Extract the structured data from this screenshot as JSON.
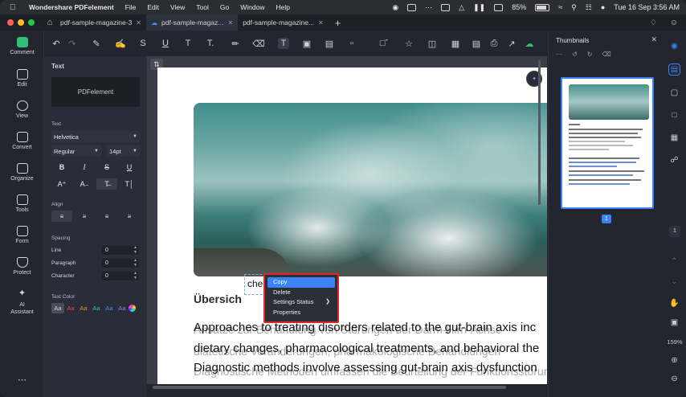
{
  "menubar": {
    "app_name": "Wondershare PDFelement",
    "items": [
      "File",
      "Edit",
      "View",
      "Tool",
      "Go",
      "Window",
      "Help"
    ],
    "battery": "85%",
    "datetime": "Tue 16 Sep  3:56 AM"
  },
  "tabs": [
    {
      "label": "pdf-sample-magazine-3",
      "active": false
    },
    {
      "label": "pdf-sample-magaz...",
      "active": true
    },
    {
      "label": "pdf-sample-magazine...",
      "active": false
    }
  ],
  "leftnav": [
    {
      "label": "Comment",
      "icon": "comment-icon",
      "active": true
    },
    {
      "label": "Edit",
      "icon": "edit-icon",
      "active": false
    },
    {
      "label": "View",
      "icon": "eye-icon",
      "active": false
    },
    {
      "label": "Convert",
      "icon": "convert-icon",
      "active": false
    },
    {
      "label": "Organize",
      "icon": "organize-icon",
      "active": false
    },
    {
      "label": "Tools",
      "icon": "tools-icon",
      "active": false
    },
    {
      "label": "Form",
      "icon": "form-icon",
      "active": false
    },
    {
      "label": "Protect",
      "icon": "shield-icon",
      "active": false
    },
    {
      "label": "AI Assistant",
      "icon": "ai-icon",
      "active": false
    }
  ],
  "props": {
    "title": "Text",
    "preview": "PDFelement",
    "text_label": "Text",
    "font": "Helvetica",
    "style": "Regular",
    "size": "14pt",
    "align_label": "Align",
    "spacing_label": "Spacing",
    "line_label": "Line",
    "line_value": "0",
    "paragraph_label": "Paragraph",
    "paragraph_value": "0",
    "character_label": "Character",
    "character_value": "0",
    "text_color_label": "Text Color",
    "swatch_text": "Aa",
    "swatch_colors": [
      "#cfd1d6",
      "#e05252",
      "#e98b2c",
      "#2ec4a8",
      "#4f8ff7",
      "#9b7bf0"
    ]
  },
  "document": {
    "edit_text": "che",
    "heading": "Übersich",
    "lines": [
      "Approaches to treating disorders related to the gut-brain axis inc",
      "dietary changes, pharmacological treatments, and behavioral the",
      "Diagnostic methods involve assessing gut-brain axis dysfunction"
    ],
    "ghost_lines": [
      "Ansätze zur Behandlung von Störungen der Darm-Hirn-Achse",
      "diätetische Veränderungen, pharmakologische Behandlungen",
      "Diagnostische Methoden umfassen die Beurteilung der Funktionsstörungen"
    ]
  },
  "context_menu": {
    "items": [
      "Copy",
      "Delete",
      "Settings Status",
      "Properties"
    ],
    "highlight_color": "#3b82f6",
    "outline_color": "#e0252a"
  },
  "thumbnails": {
    "title": "Thumbnails",
    "page_number": "1"
  },
  "rightrail": {
    "page": "1",
    "zoom": "159%"
  }
}
